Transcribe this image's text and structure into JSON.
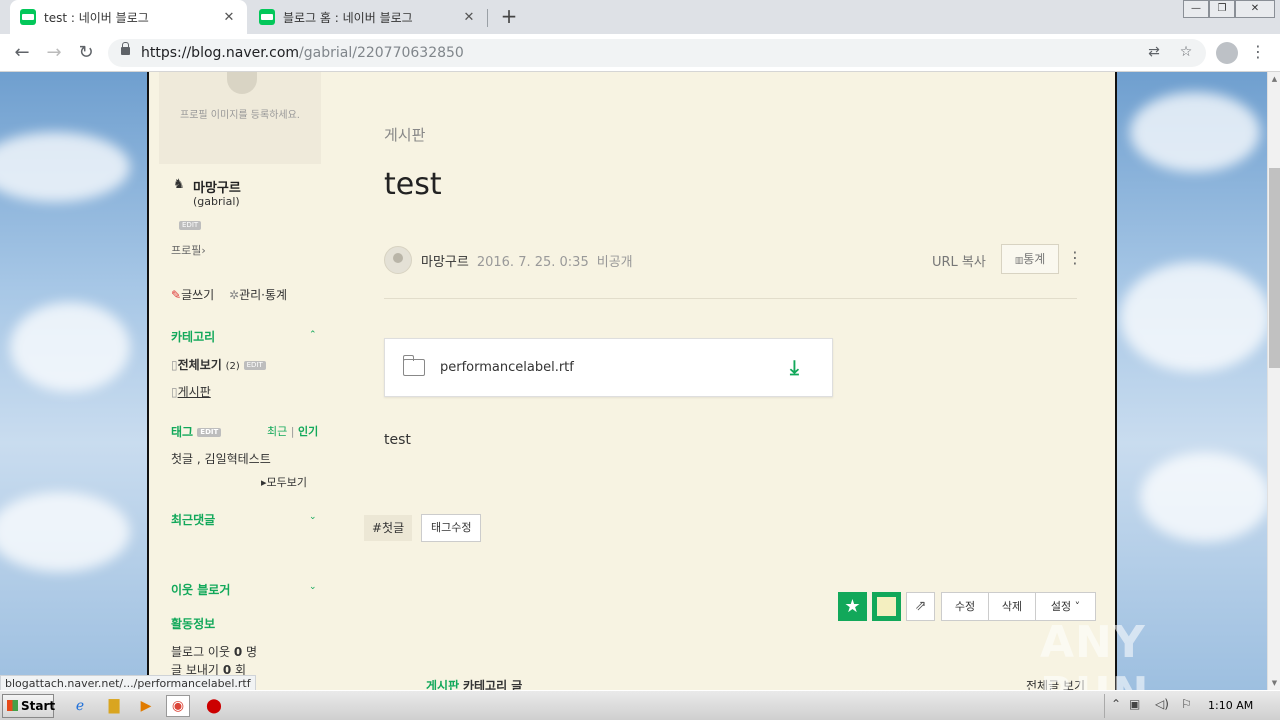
{
  "browser": {
    "tabs": [
      {
        "title": "test : 네이버 블로그",
        "active": true
      },
      {
        "title": "블로그 홈 : 네이버 블로그",
        "active": false
      }
    ],
    "url_host": "https://blog.naver.com",
    "url_path": "/gabrial/220770632850",
    "new_tab": "+",
    "window_controls": [
      "—",
      "❐",
      "✕"
    ]
  },
  "sidebar": {
    "profile_hint": "프로필 이미지를 등록하세요.",
    "nickname": "마망구르",
    "blog_id": "(gabrial)",
    "edit": "EDIT",
    "profile_link": "프로필›",
    "write": "글쓰기",
    "manage": "관리·통계",
    "category_heading": "카테고리",
    "categories": [
      {
        "label": "전체보기",
        "count": "(2)"
      },
      {
        "label": "게시판"
      }
    ],
    "tag_heading": "태그",
    "tag_sort_recent": "최근",
    "tag_sort_sep": "|",
    "tag_sort_popular": "인기",
    "tags": "첫글 , 김일혁테스트",
    "see_all": "▸모두보기",
    "recent_comments": "최근댓글",
    "neighbors": "이웃 블로거",
    "activity": "활동정보",
    "activity_neighbors_label": "블로그 이웃",
    "activity_neighbors_count": "0",
    "activity_neighbors_unit": "명",
    "activity_sent_label": "글 보내기",
    "activity_sent_count": "0",
    "activity_sent_unit": "회"
  },
  "post": {
    "category": "게시판",
    "title": "test",
    "author": "마망구르",
    "date": "2016. 7. 25. 0:35",
    "visibility": "비공개",
    "url_copy": "URL 복사",
    "stats": "통계",
    "more": "⋮",
    "file_name": "performancelabel.rtf",
    "body": "test",
    "tag": "#첫글",
    "tag_edit": "태그수정",
    "actions": [
      "수정",
      "삭제",
      "설정 ˅"
    ],
    "bottom_category": "게시판",
    "bottom_category_suffix": "카테고리 글",
    "bottom_all": "전체글 보기"
  },
  "status_url": "blogattach.naver.net/.../performancelabel.rtf",
  "watermark": "ANY RUN",
  "taskbar": {
    "start": "Start",
    "clock": "1:10 AM"
  },
  "colors": {
    "naver_green": "#12a85a",
    "page_bg": "#f7f3e2"
  }
}
